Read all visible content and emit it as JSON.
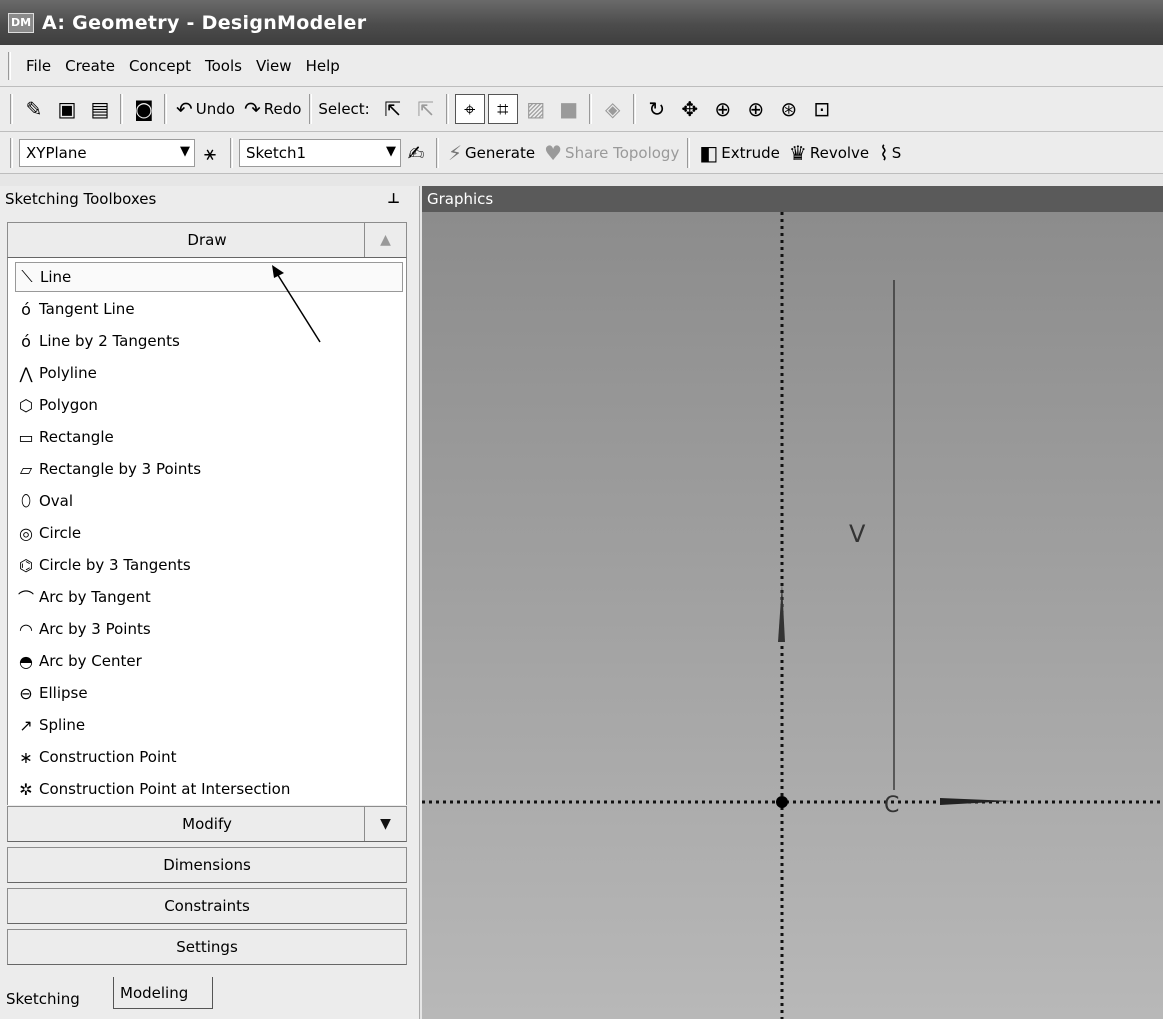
{
  "window": {
    "title": "A: Geometry - DesignModeler",
    "icon_text": "DM"
  },
  "menubar": {
    "items": [
      "File",
      "Create",
      "Concept",
      "Tools",
      "View",
      "Help"
    ]
  },
  "toolbar1": {
    "undo_label": "Undo",
    "redo_label": "Redo",
    "select_label": "Select:"
  },
  "toolbar2": {
    "plane_value": "XYPlane",
    "sketch_value": "Sketch1",
    "generate_label": "Generate",
    "share_topology_label": "Share Topology",
    "extrude_label": "Extrude",
    "revolve_label": "Revolve",
    "sweep_label_partial": "S"
  },
  "left_panel": {
    "title": "Sketching Toolboxes",
    "pin_icon": "pin-icon",
    "draw_section": "Draw",
    "draw_items": [
      "Line",
      "Tangent Line",
      "Line by 2 Tangents",
      "Polyline",
      "Polygon",
      "Rectangle",
      "Rectangle by 3 Points",
      "Oval",
      "Circle",
      "Circle by 3 Tangents",
      "Arc by Tangent",
      "Arc by 3 Points",
      "Arc by Center",
      "Ellipse",
      "Spline",
      "Construction Point",
      "Construction Point at Intersection"
    ],
    "selected_item": "Line",
    "sections": [
      "Modify",
      "Dimensions",
      "Constraints",
      "Settings"
    ],
    "tabs": [
      "Sketching",
      "Modeling"
    ]
  },
  "graphics": {
    "title": "Graphics",
    "v_label": "V"
  },
  "colors": {
    "title_bar": "#4c4c4c",
    "graphics_title": "#5a5a5a",
    "panel_bg": "#ececec",
    "graphics_top": "#8c8c8c",
    "graphics_bottom": "#b8b8b8"
  }
}
